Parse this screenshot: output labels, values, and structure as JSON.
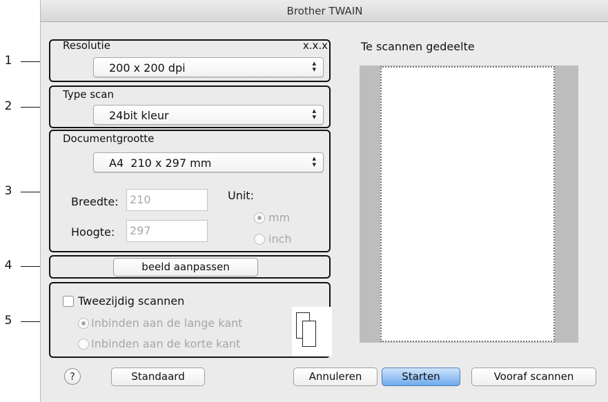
{
  "window": {
    "title": "Brother TWAIN"
  },
  "callouts": [
    "1",
    "2",
    "3",
    "4",
    "5"
  ],
  "resolution": {
    "label": "Resolutie",
    "version": "x.x.x",
    "value": "200 x 200 dpi"
  },
  "scan_type": {
    "label": "Type scan",
    "value": "24bit kleur"
  },
  "document_size": {
    "label": "Documentgrootte",
    "value": "A4  210 x 297 mm",
    "width_label": "Breedte:",
    "width_value": "210",
    "height_label": "Hoogte:",
    "height_value": "297",
    "unit_label": "Unit:",
    "unit_mm": "mm",
    "unit_inch": "inch"
  },
  "adjust": {
    "button_label": "beeld aanpassen"
  },
  "duplex": {
    "checkbox_label": "Tweezijdig scannen",
    "long_edge_label": "Inbinden aan de lange kant",
    "short_edge_label": "Inbinden aan de korte kant"
  },
  "preview": {
    "label": "Te scannen gedeelte"
  },
  "footer": {
    "help_label": "?",
    "default_button": "Standaard",
    "cancel_button": "Annuleren",
    "start_button": "Starten",
    "prescan_button": "Vooraf scannen"
  },
  "colors": {
    "accent": "#6ea9ee",
    "window_bg": "#ebebeb",
    "disabled_text": "#a6a6a6"
  }
}
